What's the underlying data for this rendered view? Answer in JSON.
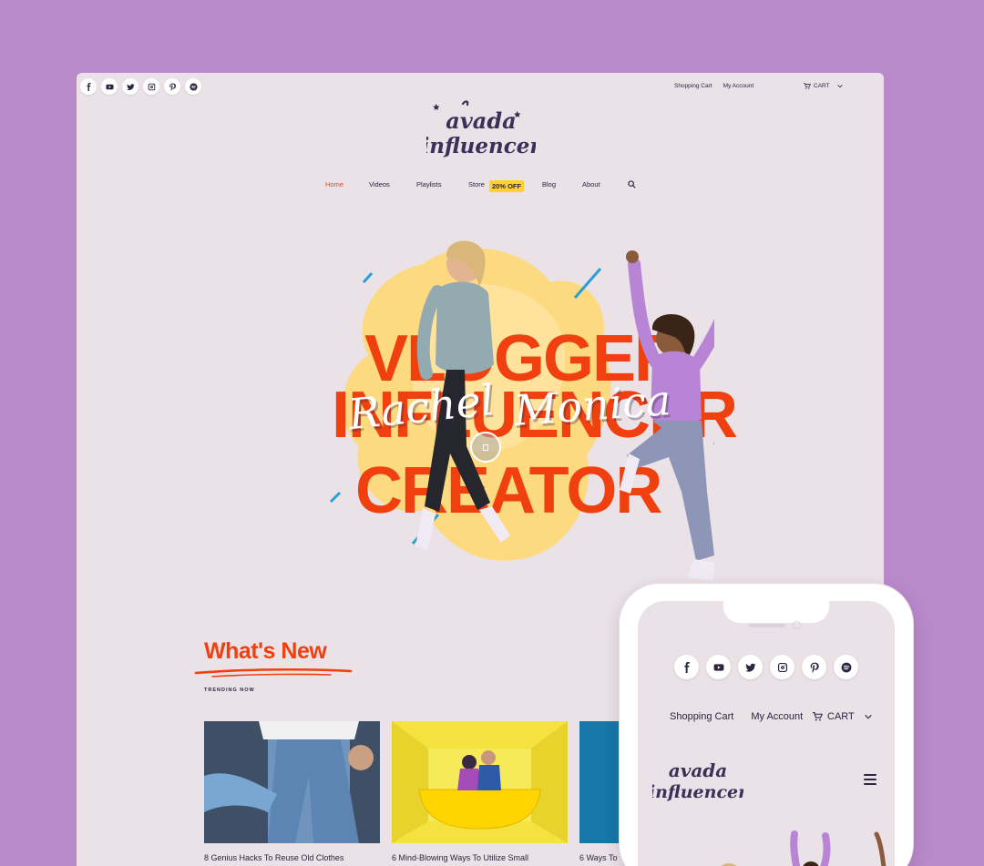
{
  "desktop": {
    "social_icons": [
      "facebook-icon",
      "youtube-icon",
      "twitter-icon",
      "instagram-icon",
      "pinterest-icon",
      "spotify-icon"
    ],
    "top_links": [
      "Shopping Cart",
      "My Account"
    ],
    "cart_label": "CART",
    "logo": {
      "line1": "avada",
      "line2": "influencer"
    },
    "nav": {
      "home": "Home",
      "videos": "Videos",
      "playlists": "Playlists",
      "store": "Store",
      "store_badge": "20% OFF",
      "blog": "Blog",
      "about": "About"
    },
    "hero": {
      "word1": "VLOGGER",
      "word2": "INFLUENCER",
      "word3": "CREATOR",
      "script1": "Rachel",
      "script2": "Monica"
    },
    "whats_new": {
      "title": "What's New",
      "subtitle": "TRENDING NOW",
      "cards": [
        {
          "title": "8 Genius Hacks To Reuse Old Clothes"
        },
        {
          "title": "6 Mind-Blowing Ways To Utilize Small"
        },
        {
          "title": "6 Ways To"
        }
      ]
    }
  },
  "phone": {
    "social_icons": [
      "facebook-icon",
      "youtube-icon",
      "twitter-icon",
      "instagram-icon",
      "pinterest-icon",
      "spotify-icon"
    ],
    "links": [
      "Shopping Cart",
      "My Account"
    ],
    "cart_label": "CART",
    "logo": {
      "line1": "avada",
      "line2": "influencer"
    }
  },
  "colors": {
    "background": "#b98acb",
    "page": "#eae2e6",
    "accent": "#f0400f",
    "text": "#2c2440",
    "badge": "#ffd22b"
  }
}
